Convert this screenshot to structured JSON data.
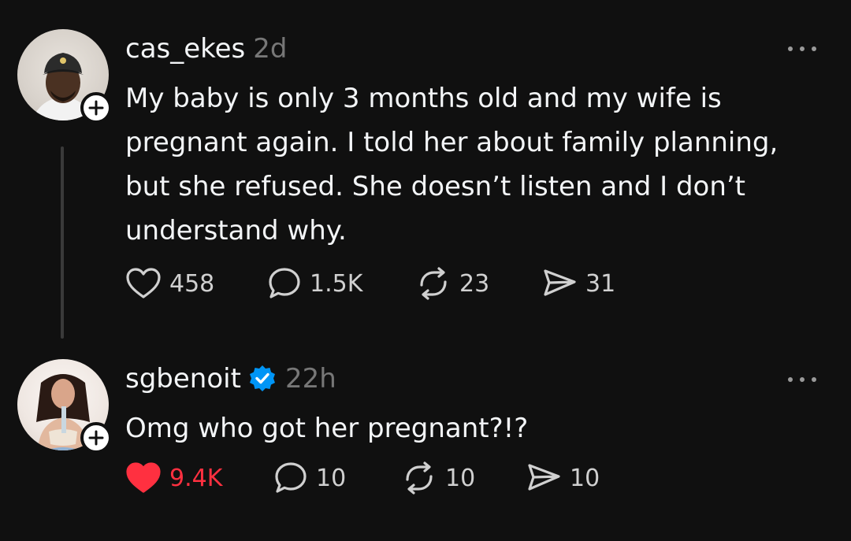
{
  "posts": [
    {
      "username": "cas_ekes",
      "time": "2d",
      "verified": false,
      "text": "My baby is only 3 months old and my wife is pregnant again. I told her about family planning, but she refused. She doesn’t listen and I don’t understand why.",
      "likes": "458",
      "replies": "1.5K",
      "reposts": "23",
      "shares": "31",
      "liked": false
    },
    {
      "username": "sgbenoit",
      "time": "22h",
      "verified": true,
      "text": "Omg who got her pregnant?!?",
      "likes": "9.4K",
      "replies": "10",
      "reposts": "10",
      "shares": "10",
      "liked": true
    }
  ],
  "colors": {
    "background": "#101010",
    "like_active": "#ff3040",
    "verified": "#0095f6",
    "secondary_text": "#777777"
  }
}
